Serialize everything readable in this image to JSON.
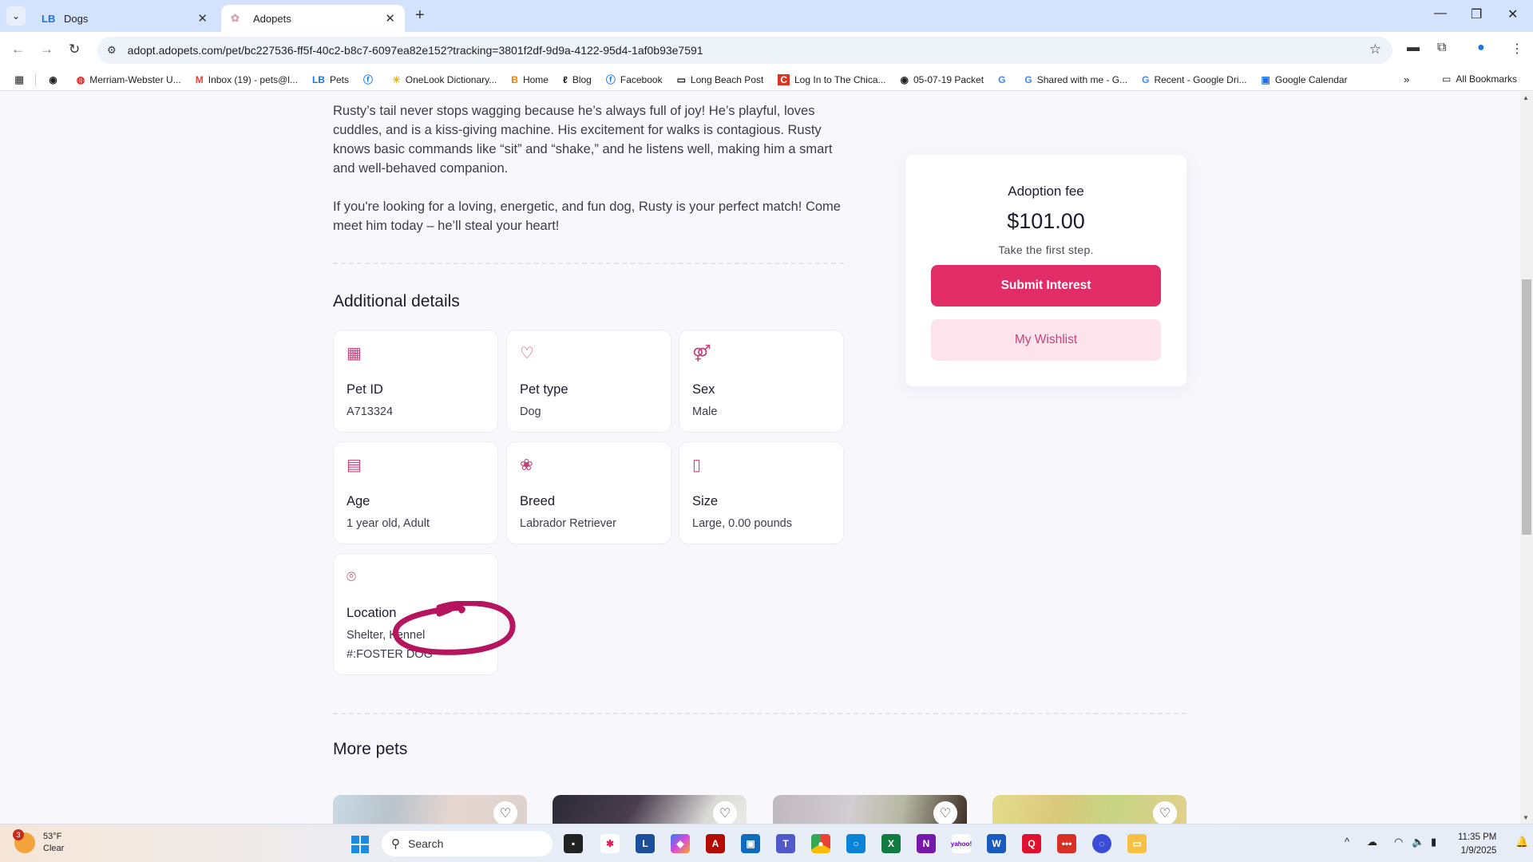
{
  "browser": {
    "tabs": [
      {
        "label": "Dogs",
        "favicon": "LB",
        "active": false
      },
      {
        "label": "Adopets",
        "favicon": "adopets-paw-icon",
        "active": true
      }
    ],
    "url": "adopt.adopets.com/pet/bc227536-ff5f-40c2-b8c7-6097ea82e152?tracking=3801f2df-9d9a-4122-95d4-1af0b93e7591",
    "bookmarks": [
      {
        "label": "Merriam-Webster U...",
        "icon": "merriam-webster-icon"
      },
      {
        "label": "Inbox (19) - pets@l...",
        "icon": "gmail-icon"
      },
      {
        "label": "Pets",
        "icon": "lb-icon"
      },
      {
        "label": "",
        "icon": "facebook-icon"
      },
      {
        "label": "OneLook Dictionary...",
        "icon": "onelook-icon"
      },
      {
        "label": "Home",
        "icon": "blogger-icon"
      },
      {
        "label": "Blog",
        "icon": "blog-icon"
      },
      {
        "label": "Facebook",
        "icon": "facebook-icon"
      },
      {
        "label": "Long Beach Post",
        "icon": "folder-icon"
      },
      {
        "label": "Log In to The Chica...",
        "icon": "chicago-icon"
      },
      {
        "label": "05-07-19 Packet",
        "icon": "globe-icon"
      },
      {
        "label": "",
        "icon": "google-icon"
      },
      {
        "label": "Shared with me - G...",
        "icon": "google-icon"
      },
      {
        "label": "Recent - Google Dri...",
        "icon": "google-icon"
      },
      {
        "label": "Google Calendar",
        "icon": "calendar-icon"
      }
    ],
    "all_bookmarks": "All Bookmarks",
    "more_chevron": "»"
  },
  "pet": {
    "description": [
      "Rusty’s tail never stops wagging because he’s always full of joy! He’s playful, loves cuddles, and is a kiss-giving machine. His excitement for walks is contagious. Rusty knows basic commands like “sit” and “shake,” and he listens well, making him a smart and well-behaved companion.",
      "If you're looking for a loving, energetic, and fun dog, Rusty is your perfect match! Come meet him today – he’ll steal your heart!"
    ],
    "additional_details_title": "Additional details",
    "details": [
      {
        "icon": "qr-code-icon",
        "glyph": "▦",
        "label": "Pet ID",
        "value": "A713324"
      },
      {
        "icon": "heart-icon",
        "glyph": "♡",
        "label": "Pet type",
        "value": "Dog"
      },
      {
        "icon": "gender-icon",
        "glyph": "⚤",
        "label": "Sex",
        "value": "Male"
      },
      {
        "icon": "calendar-icon",
        "glyph": "▤",
        "label": "Age",
        "value": "1 year old, Adult"
      },
      {
        "icon": "paw-icon",
        "glyph": "❀",
        "label": "Breed",
        "value": "Labrador Retriever"
      },
      {
        "icon": "ruler-icon",
        "glyph": "▯",
        "label": "Size",
        "value": "Large, 0.00 pounds"
      },
      {
        "icon": "location-pin-icon",
        "glyph": "⌾",
        "label": "Location",
        "value": "Shelter, Kennel #:FOSTER DOG"
      }
    ],
    "more_pets_title": "More pets",
    "more_pets_count": 4
  },
  "adoption": {
    "label": "Adoption fee",
    "amount": "$101.00",
    "subtitle": "Take the first step.",
    "submit_label": "Submit Interest",
    "wishlist_label": "My Wishlist"
  },
  "colors": {
    "brand_pink": "#e12c68",
    "wishlist_bg": "#fde4ec",
    "icon_pink": "#c2447a",
    "annotation": "#b5155e"
  },
  "taskbar": {
    "weather_temp": "53°F",
    "weather_desc": "Clear",
    "weather_badge": "3",
    "search_placeholder": "Search",
    "time": "11:35 PM",
    "date": "1/9/2025"
  }
}
